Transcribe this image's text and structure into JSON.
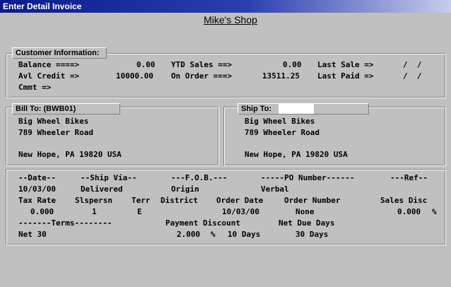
{
  "window": {
    "title": "Enter Detail Invoice"
  },
  "shop": {
    "name": "Mike's Shop"
  },
  "customer": {
    "legend": "Customer Information:",
    "balance_label": "Balance ====>",
    "balance_value": "0.00",
    "ytd_label": "YTD Sales ==>",
    "ytd_value": "0.00",
    "last_sale_label": "Last Sale =>",
    "last_sale_value": "/  /",
    "avl_label": "Avl Credit =>",
    "avl_value": "10000.00",
    "on_order_label": "On Order ===>",
    "on_order_value": "13511.25",
    "last_paid_label": "Last Paid =>",
    "last_paid_value": "/  /",
    "cmmt_label": "Cmmt =>"
  },
  "bill_to": {
    "legend": "Bill To: (BWB01)",
    "line1": "Big Wheel Bikes",
    "line2": "789 Wheeler Road",
    "line3": "New Hope, PA 19820 USA"
  },
  "ship_to": {
    "legend": "Ship To:",
    "code": "",
    "line1": "Big Wheel Bikes",
    "line2": "789 Wheeler Road",
    "line3": "New Hope, PA 19820 USA"
  },
  "details": {
    "h_date": "--Date--",
    "h_ship": "--Ship Via--",
    "h_fob": "---F.O.B.---",
    "h_po": "-----PO Number------",
    "h_ref": "---Ref--",
    "date": "10/03/00",
    "ship_via": "Delivered",
    "fob": "Origin",
    "po": "Verbal",
    "h_tax": "Tax Rate",
    "h_slsp": "Slspersn",
    "h_terr": "Terr",
    "h_district": "District",
    "h_order_date": "Order Date",
    "h_order_num": "Order Number",
    "h_sales_disc": "Sales Disc",
    "tax": "0.000",
    "slsp": "1",
    "terr": "E",
    "order_date": "10/03/00",
    "order_num": "None",
    "sales_disc": "0.000",
    "sales_disc_unit": "%",
    "h_terms": "-------Terms--------",
    "h_pay_disc": "Payment Discount",
    "h_net_due": "Net Due Days",
    "terms": "Net 30",
    "pay_disc_pct": "2.000",
    "pay_disc_unit": "%",
    "pay_disc_days": "10 Days",
    "net_due": "30 Days"
  }
}
